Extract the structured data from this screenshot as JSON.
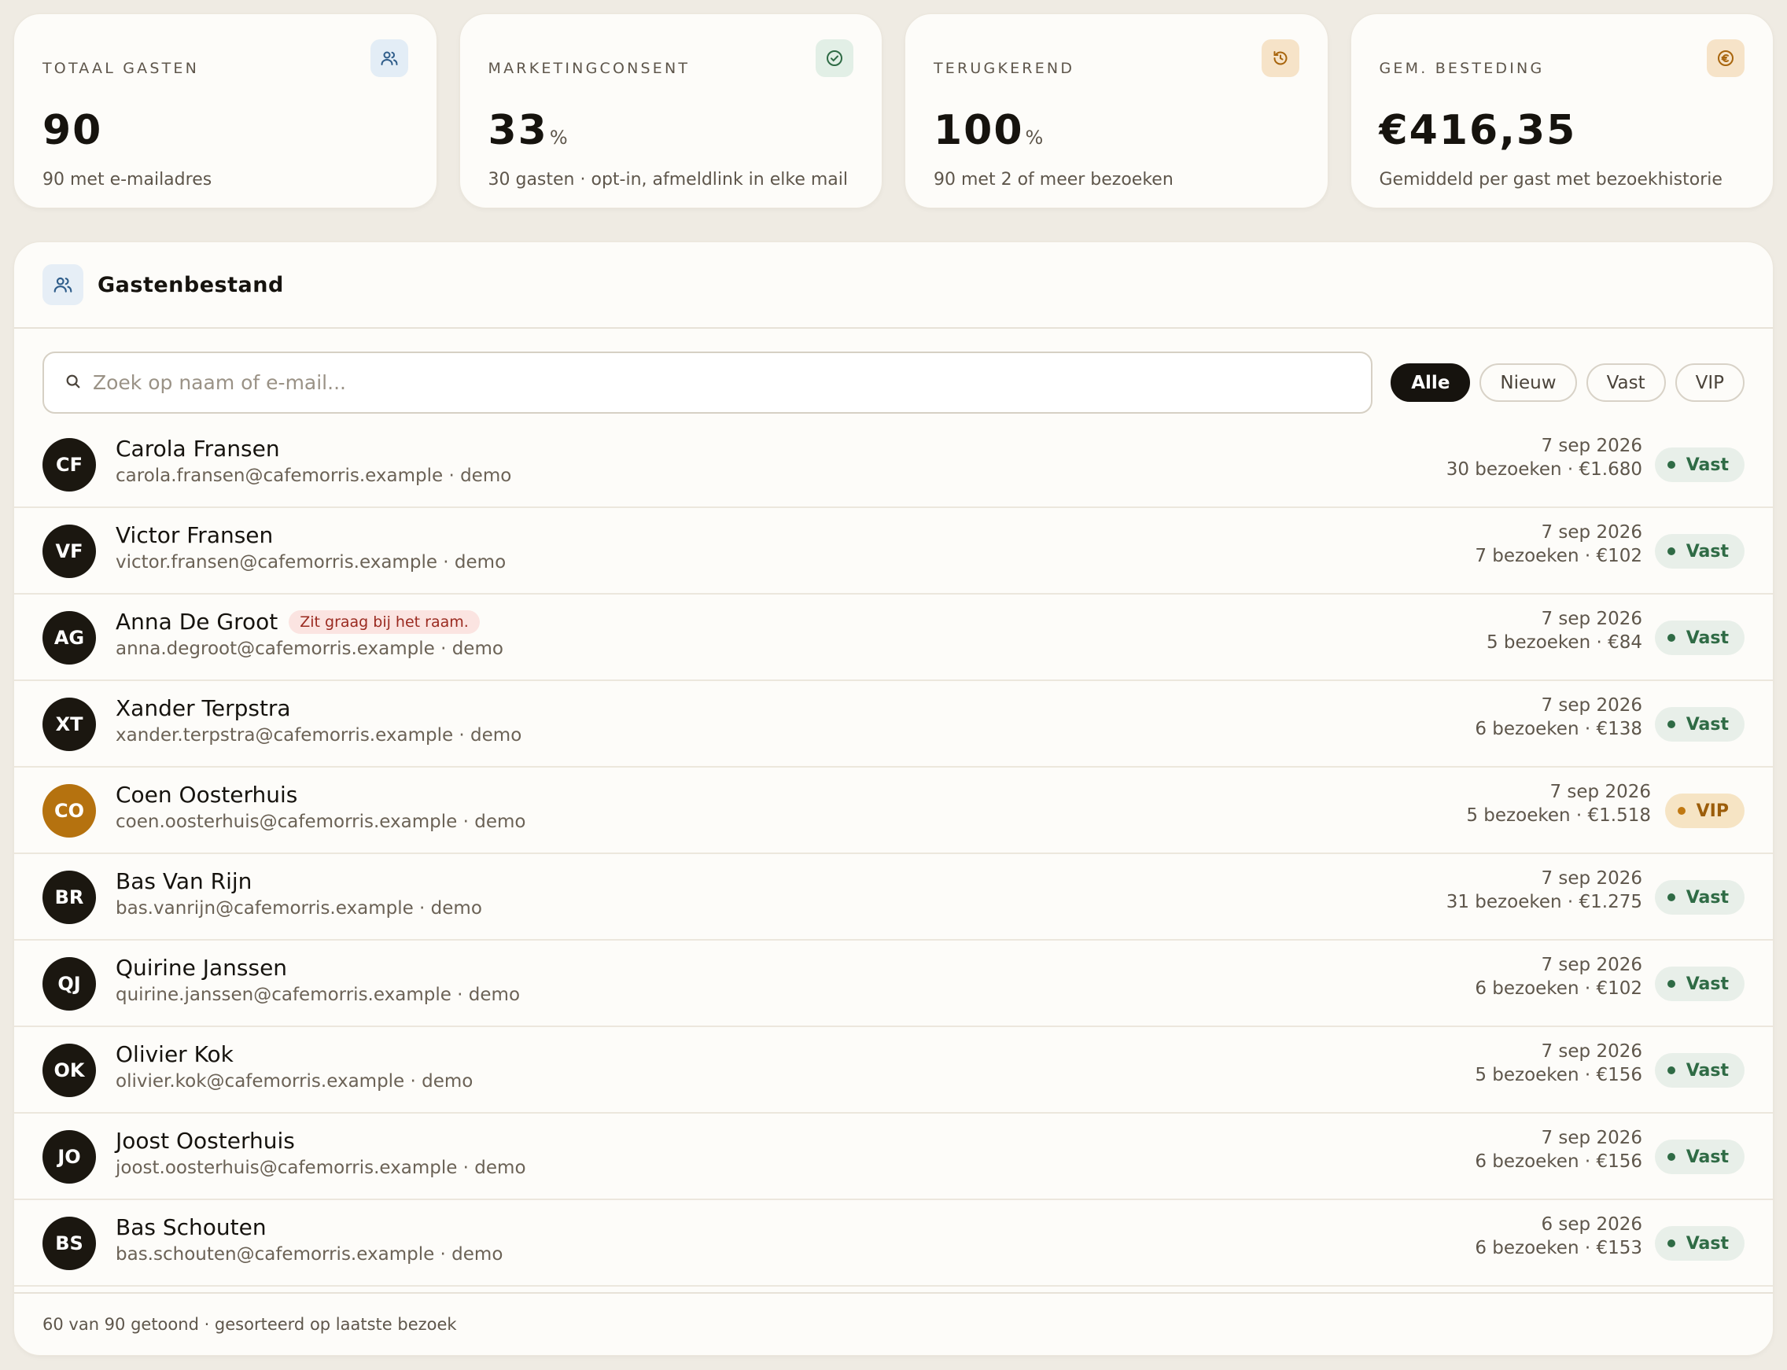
{
  "stats": [
    {
      "label": "TOTAAL GASTEN",
      "value": "90",
      "unit": "",
      "sub": "90 met e-mailadres",
      "icon": "users-icon",
      "icon_bg": "#e3edf6",
      "icon_color": "#2f5d8a"
    },
    {
      "label": "MARKETINGCONSENT",
      "value": "33",
      "unit": "%",
      "sub": "30 gasten · opt-in, afmeldlink in elke mail",
      "icon": "check-circle-icon",
      "icon_bg": "#e2efe6",
      "icon_color": "#2f6b45"
    },
    {
      "label": "TERUGKEREND",
      "value": "100",
      "unit": "%",
      "sub": "90 met 2 of meer bezoeken",
      "icon": "refresh-icon",
      "icon_bg": "#f6e3c8",
      "icon_color": "#a8650d"
    },
    {
      "label": "GEM. BESTEDING",
      "value": "€416,35",
      "unit": "",
      "sub": "Gemiddeld per gast met bezoekhistorie",
      "icon": "euro-icon",
      "icon_bg": "#f6e3c8",
      "icon_color": "#a8650d"
    }
  ],
  "panel": {
    "title": "Gastenbestand",
    "search_placeholder": "Zoek op naam of e-mail...",
    "filters": [
      "Alle",
      "Nieuw",
      "Vast",
      "VIP"
    ],
    "active_filter": "Alle",
    "footer": "60 van 90 getoond · gesorteerd op laatste bezoek"
  },
  "guests": [
    {
      "initials": "CF",
      "name": "Carola Fransen",
      "note": "",
      "email": "carola.fransen@cafemorris.example · demo",
      "date": "7 sep 2026",
      "visits": "30 bezoeken · €1.680",
      "badge": "Vast"
    },
    {
      "initials": "VF",
      "name": "Victor Fransen",
      "note": "",
      "email": "victor.fransen@cafemorris.example · demo",
      "date": "7 sep 2026",
      "visits": "7 bezoeken · €102",
      "badge": "Vast"
    },
    {
      "initials": "AG",
      "name": "Anna De Groot",
      "note": "Zit graag bij het raam.",
      "email": "anna.degroot@cafemorris.example · demo",
      "date": "7 sep 2026",
      "visits": "5 bezoeken · €84",
      "badge": "Vast"
    },
    {
      "initials": "XT",
      "name": "Xander Terpstra",
      "note": "",
      "email": "xander.terpstra@cafemorris.example · demo",
      "date": "7 sep 2026",
      "visits": "6 bezoeken · €138",
      "badge": "Vast"
    },
    {
      "initials": "CO",
      "name": "Coen Oosterhuis",
      "note": "",
      "email": "coen.oosterhuis@cafemorris.example · demo",
      "date": "7 sep 2026",
      "visits": "5 bezoeken · €1.518",
      "badge": "VIP"
    },
    {
      "initials": "BR",
      "name": "Bas Van Rijn",
      "note": "",
      "email": "bas.vanrijn@cafemorris.example · demo",
      "date": "7 sep 2026",
      "visits": "31 bezoeken · €1.275",
      "badge": "Vast"
    },
    {
      "initials": "QJ",
      "name": "Quirine Janssen",
      "note": "",
      "email": "quirine.janssen@cafemorris.example · demo",
      "date": "7 sep 2026",
      "visits": "6 bezoeken · €102",
      "badge": "Vast"
    },
    {
      "initials": "OK",
      "name": "Olivier Kok",
      "note": "",
      "email": "olivier.kok@cafemorris.example · demo",
      "date": "7 sep 2026",
      "visits": "5 bezoeken · €156",
      "badge": "Vast"
    },
    {
      "initials": "JO",
      "name": "Joost Oosterhuis",
      "note": "",
      "email": "joost.oosterhuis@cafemorris.example · demo",
      "date": "7 sep 2026",
      "visits": "6 bezoeken · €156",
      "badge": "Vast"
    },
    {
      "initials": "BS",
      "name": "Bas Schouten",
      "note": "",
      "email": "bas.schouten@cafemorris.example · demo",
      "date": "6 sep 2026",
      "visits": "6 bezoeken · €153",
      "badge": "Vast"
    }
  ]
}
